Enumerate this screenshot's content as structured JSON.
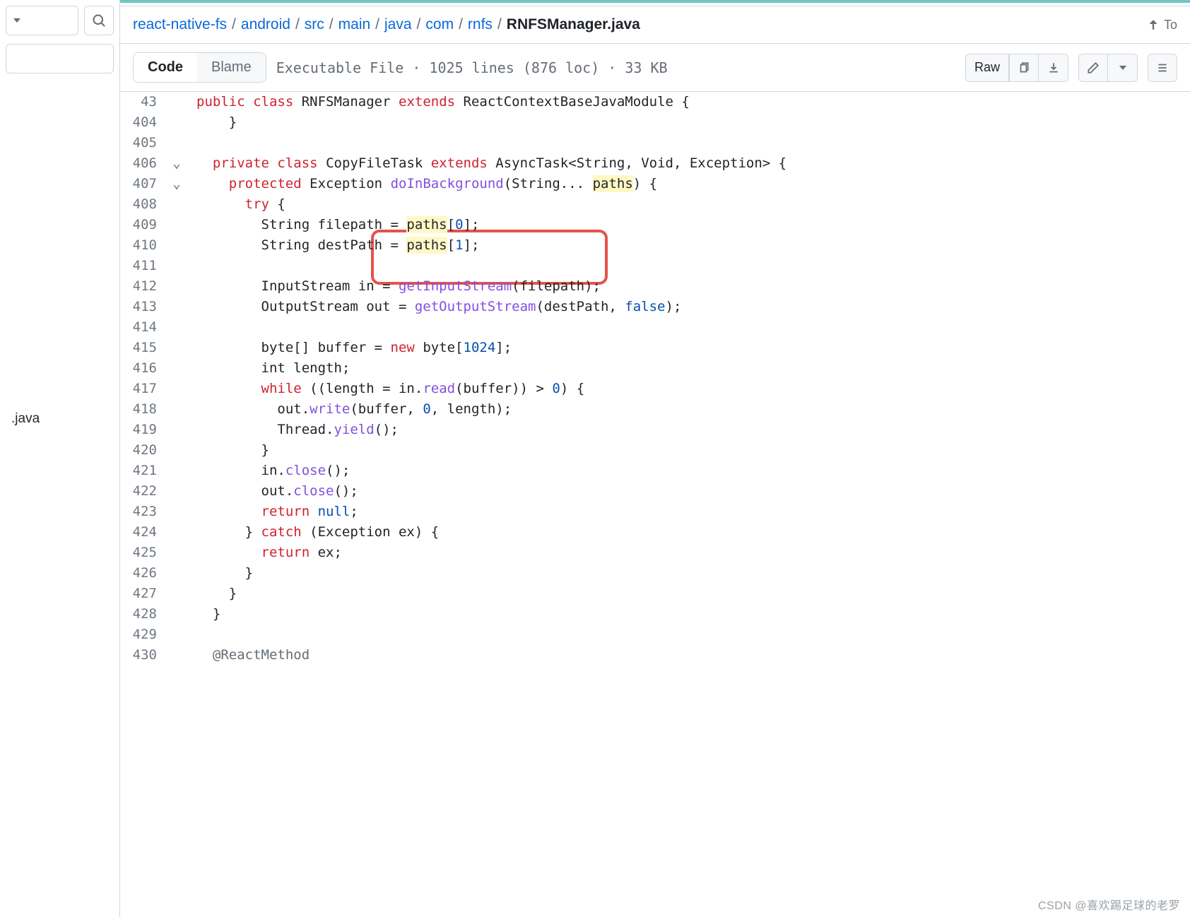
{
  "sidebar": {
    "file_label": ".java"
  },
  "breadcrumb": {
    "root": "react-native-fs",
    "parts": [
      "android",
      "src",
      "main",
      "java",
      "com",
      "rnfs"
    ],
    "file": "RNFSManager.java",
    "top_label": "To"
  },
  "tabs": {
    "code": "Code",
    "blame": "Blame"
  },
  "meta": {
    "text": "Executable File · 1025 lines (876 loc) · 33 KB"
  },
  "buttons": {
    "raw": "Raw"
  },
  "lines": {
    "l43_num": "43",
    "l404_num": "404",
    "l405_num": "405",
    "l406_num": "406",
    "l407_num": "407",
    "l408_num": "408",
    "l409_num": "409",
    "l410_num": "410",
    "l411_num": "411",
    "l412_num": "412",
    "l413_num": "413",
    "l414_num": "414",
    "l415_num": "415",
    "l416_num": "416",
    "l417_num": "417",
    "l418_num": "418",
    "l419_num": "419",
    "l420_num": "420",
    "l421_num": "421",
    "l422_num": "422",
    "l423_num": "423",
    "l424_num": "424",
    "l425_num": "425",
    "l426_num": "426",
    "l427_num": "427",
    "l428_num": "428",
    "l429_num": "429",
    "l430_num": "430"
  },
  "code": {
    "l43_a": "public",
    "l43_b": "class",
    "l43_c": " RNFSManager ",
    "l43_d": "extends",
    "l43_e": " ReactContextBaseJavaModule {",
    "l404": "    }",
    "l406_a": "  ",
    "l406_b": "private",
    "l406_c": " ",
    "l406_d": "class",
    "l406_e": " CopyFileTask ",
    "l406_f": "extends",
    "l406_g": " AsyncTask<String, Void, Exception> {",
    "l407_a": "    ",
    "l407_b": "protected",
    "l407_c": " Exception ",
    "l407_d": "doInBackground",
    "l407_e": "(String... ",
    "l407_f": "paths",
    "l407_g": ") {",
    "l408_a": "      ",
    "l408_b": "try",
    "l408_c": " {",
    "l409_a": "        String filepath = ",
    "l409_b": "paths",
    "l409_c": "[",
    "l409_d": "0",
    "l409_e": "];",
    "l410_a": "        String destPath = ",
    "l410_b": "paths",
    "l410_c": "[",
    "l410_d": "1",
    "l410_e": "];",
    "l412_a": "        InputStream in = ",
    "l412_b": "getInputStream",
    "l412_c": "(filepath);",
    "l413_a": "        OutputStream out = ",
    "l413_b": "getOutputStream",
    "l413_c": "(destPath, ",
    "l413_d": "false",
    "l413_e": ");",
    "l415_a": "        byte[] buffer = ",
    "l415_b": "new",
    "l415_c": " byte[",
    "l415_d": "1024",
    "l415_e": "];",
    "l416": "        int length;",
    "l417_a": "        ",
    "l417_b": "while",
    "l417_c": " ((length = in.",
    "l417_d": "read",
    "l417_e": "(buffer)) > ",
    "l417_f": "0",
    "l417_g": ") {",
    "l418_a": "          out.",
    "l418_b": "write",
    "l418_c": "(buffer, ",
    "l418_d": "0",
    "l418_e": ", length);",
    "l419_a": "          Thread.",
    "l419_b": "yield",
    "l419_c": "();",
    "l420": "        }",
    "l421_a": "        in.",
    "l421_b": "close",
    "l421_c": "();",
    "l422_a": "        out.",
    "l422_b": "close",
    "l422_c": "();",
    "l423_a": "        ",
    "l423_b": "return",
    "l423_c": " ",
    "l423_d": "null",
    "l423_e": ";",
    "l424_a": "      } ",
    "l424_b": "catch",
    "l424_c": " (Exception ex) {",
    "l425_a": "        ",
    "l425_b": "return",
    "l425_c": " ex;",
    "l426": "      }",
    "l427": "    }",
    "l428": "  }",
    "l430_a": "  ",
    "l430_b": "@ReactMethod"
  },
  "watermark": "CSDN @喜欢踢足球的老罗"
}
